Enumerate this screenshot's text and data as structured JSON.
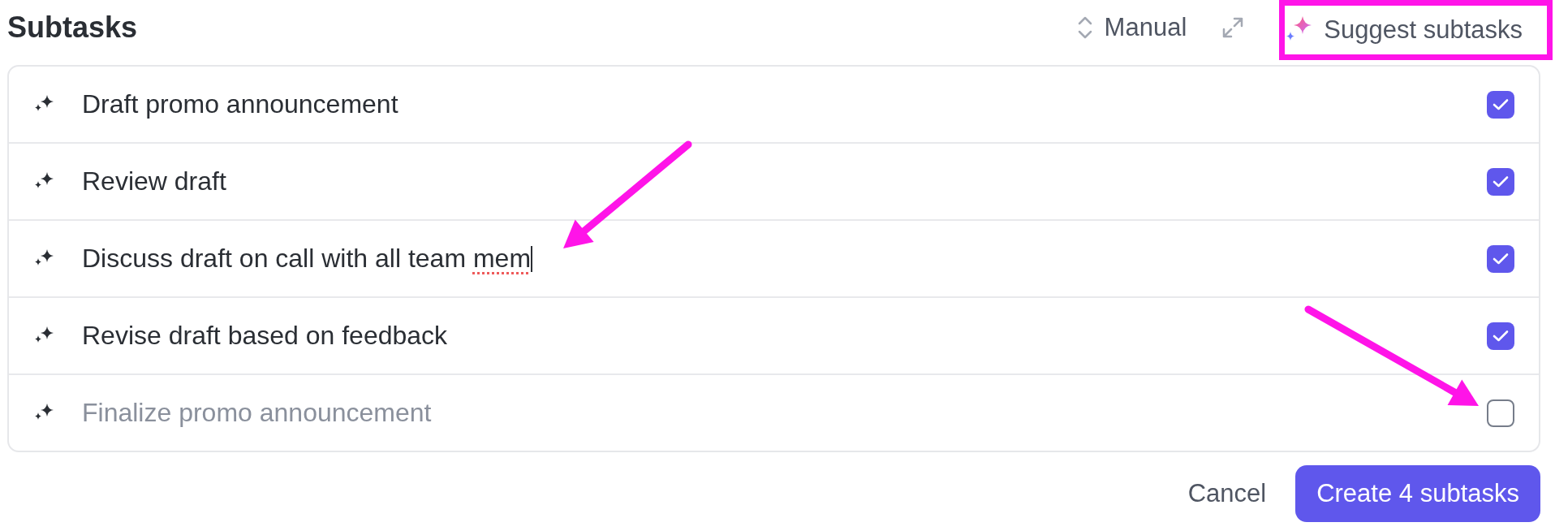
{
  "header": {
    "title": "Subtasks",
    "sort": {
      "label": "Manual"
    },
    "suggest": {
      "label": "Suggest subtasks",
      "highlighted": true
    }
  },
  "subtasks": [
    {
      "label": "Draft promo announcement",
      "checked": true,
      "focused": false,
      "spell_error": false
    },
    {
      "label": "Review draft",
      "checked": true,
      "focused": false,
      "spell_error": false
    },
    {
      "label": "Discuss draft on call with all team mem",
      "checked": true,
      "focused": true,
      "spell_error": true
    },
    {
      "label": "Revise draft based on feedback",
      "checked": true,
      "focused": false,
      "spell_error": false
    },
    {
      "label": "Finalize promo announcement",
      "checked": false,
      "focused": false,
      "spell_error": false
    }
  ],
  "footer": {
    "cancel": "Cancel",
    "create": "Create 4 subtasks"
  },
  "annotations": [
    {
      "kind": "arrow"
    },
    {
      "kind": "arrow"
    }
  ]
}
